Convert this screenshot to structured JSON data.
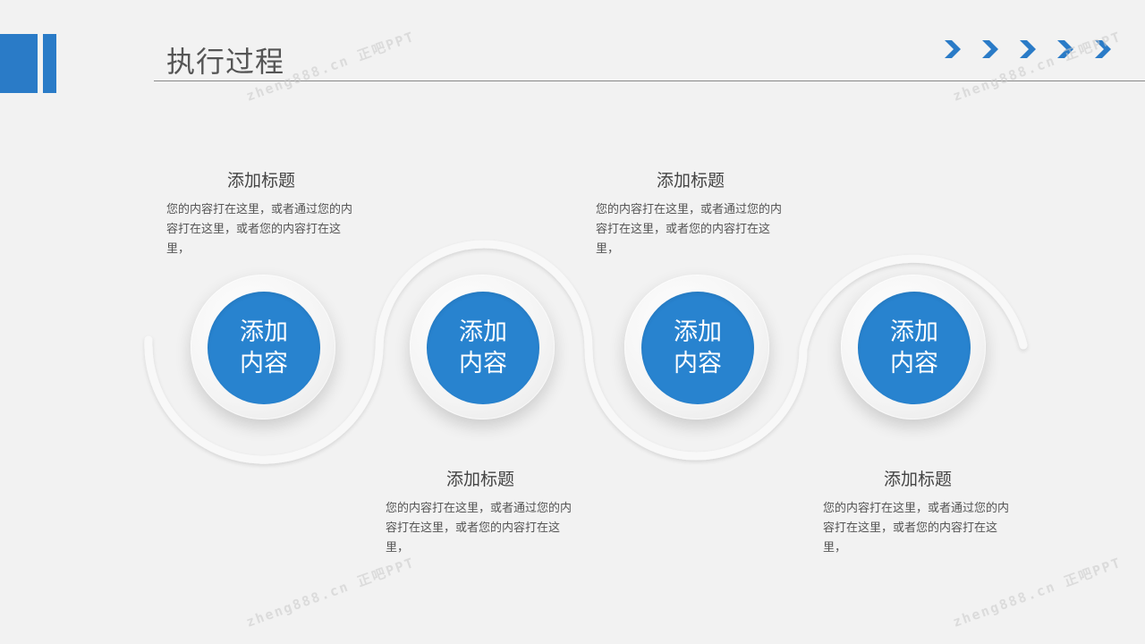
{
  "header": {
    "title": "执行过程"
  },
  "steps": [
    {
      "label": "添加内容",
      "title": "添加标题",
      "body": "您的内容打在这里，或者通过您的内容打在这里，或者您的内容打在这里，"
    },
    {
      "label": "添加内容",
      "title": "添加标题",
      "body": "您的内容打在这里，或者通过您的内容打在这里，或者您的内容打在这里，"
    },
    {
      "label": "添加内容",
      "title": "添加标题",
      "body": "您的内容打在这里，或者通过您的内容打在这里，或者您的内容打在这里，"
    },
    {
      "label": "添加内容",
      "title": "添加标题",
      "body": "您的内容打在这里，或者通过您的内容打在这里，或者您的内容打在这里，"
    }
  ],
  "watermark": {
    "text": "zheng888.cn 正吧PPT"
  },
  "colors": {
    "accent": "#2883cf",
    "background": "#f2f2f2"
  }
}
